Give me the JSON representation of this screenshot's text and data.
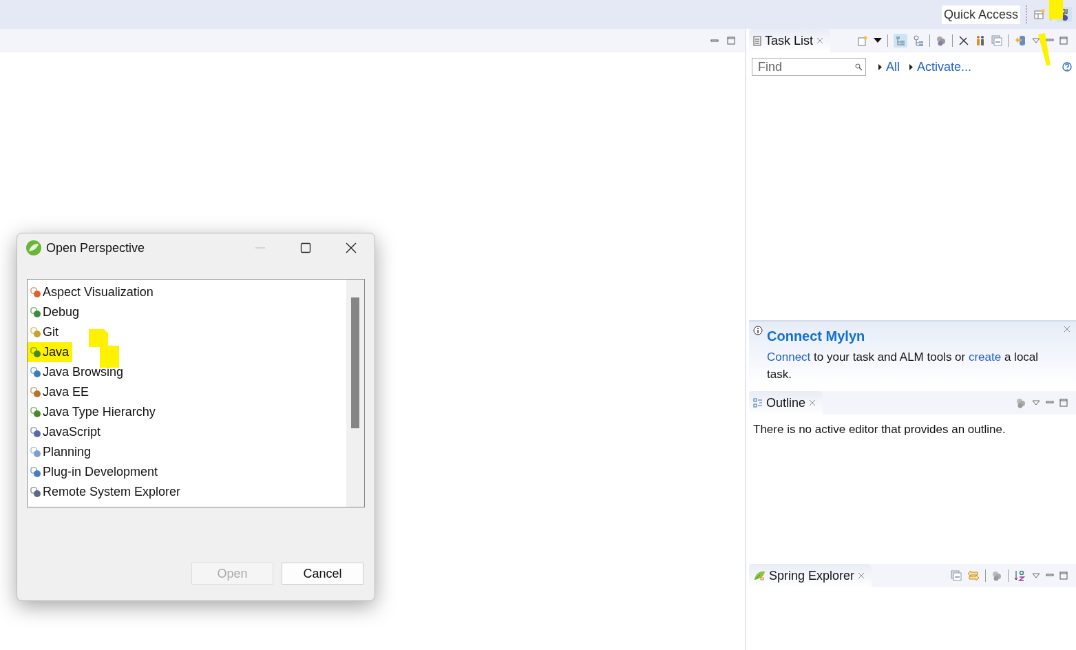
{
  "toolbar": {
    "quick_access": "Quick Access"
  },
  "task_list": {
    "tab": "Task List",
    "find_placeholder": "Find",
    "links": [
      "All",
      "Activate..."
    ]
  },
  "mylyn": {
    "title": "Connect Mylyn",
    "parts": [
      {
        "kind": "link",
        "text": "Connect"
      },
      {
        "kind": "text",
        "text": " to your task and ALM tools or "
      },
      {
        "kind": "link",
        "text": "create"
      },
      {
        "kind": "text",
        "text": " a local task."
      }
    ]
  },
  "outline": {
    "tab": "Outline",
    "message": "There is no active editor that provides an outline."
  },
  "spring_explorer": {
    "tab": "Spring Explorer"
  },
  "dialog": {
    "title": "Open Perspective",
    "items": [
      {
        "label": "Aspect Visualization",
        "highlighted": false
      },
      {
        "label": "Debug",
        "highlighted": false
      },
      {
        "label": "Git",
        "highlighted": false
      },
      {
        "label": "Java",
        "highlighted": true
      },
      {
        "label": "Java Browsing",
        "highlighted": false
      },
      {
        "label": "Java EE",
        "highlighted": false
      },
      {
        "label": "Java Type Hierarchy",
        "highlighted": false
      },
      {
        "label": "JavaScript",
        "highlighted": false
      },
      {
        "label": "Planning",
        "highlighted": false
      },
      {
        "label": "Plug-in Development",
        "highlighted": false
      },
      {
        "label": "Remote System Explorer",
        "highlighted": false
      }
    ],
    "buttons": [
      {
        "label": "Open",
        "disabled": true
      },
      {
        "label": "Cancel",
        "disabled": false
      }
    ]
  }
}
